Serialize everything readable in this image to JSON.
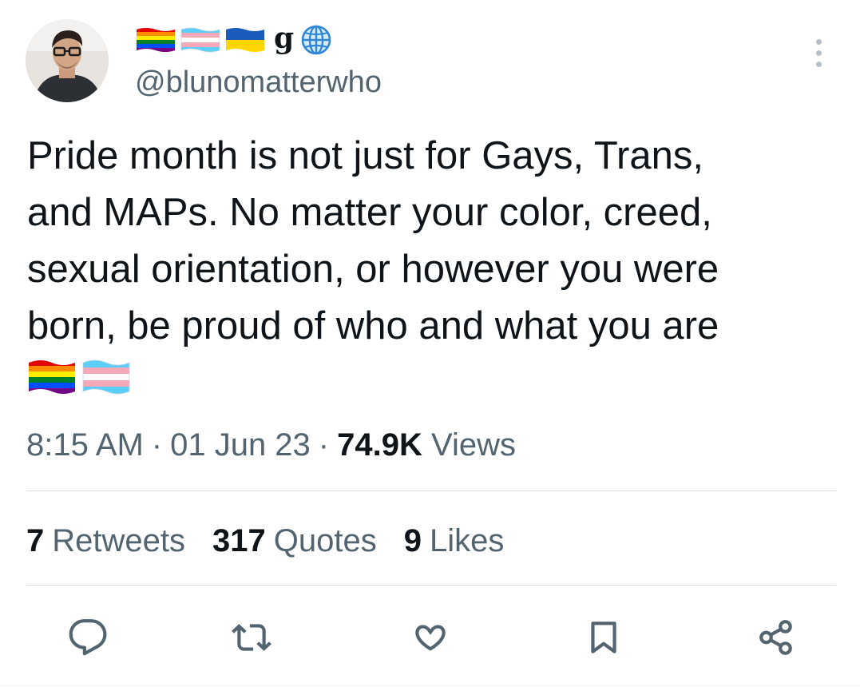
{
  "author": {
    "display_name_letter": "g",
    "display_name_icons": [
      "rainbow-flag-icon",
      "transgender-flag-icon",
      "ukraine-flag-icon",
      "globe-icon"
    ],
    "handle": "@blunomatterwho"
  },
  "tweet": {
    "text_lines": [
      "Pride month is not just for Gays, Trans,",
      "and MAPs. No matter your color, creed,",
      "sexual orientation, or however you were",
      "born, be proud of who and what you are"
    ],
    "trailing_emoji": [
      "rainbow-flag-icon",
      "transgender-flag-icon"
    ]
  },
  "meta": {
    "time": "8:15 AM",
    "separator": "·",
    "date": "01 Jun 23",
    "views_count": "74.9K",
    "views_label": "Views"
  },
  "stats": {
    "retweets_count": "7",
    "retweets_label": "Retweets",
    "quotes_count": "317",
    "quotes_label": "Quotes",
    "likes_count": "9",
    "likes_label": "Likes"
  },
  "actions": [
    "reply-icon",
    "retweet-icon",
    "like-icon",
    "bookmark-icon",
    "share-icon"
  ],
  "colors": {
    "text_primary": "#0f1419",
    "text_secondary": "#536471",
    "divider": "#dbe1e6",
    "icon": "#536471"
  }
}
